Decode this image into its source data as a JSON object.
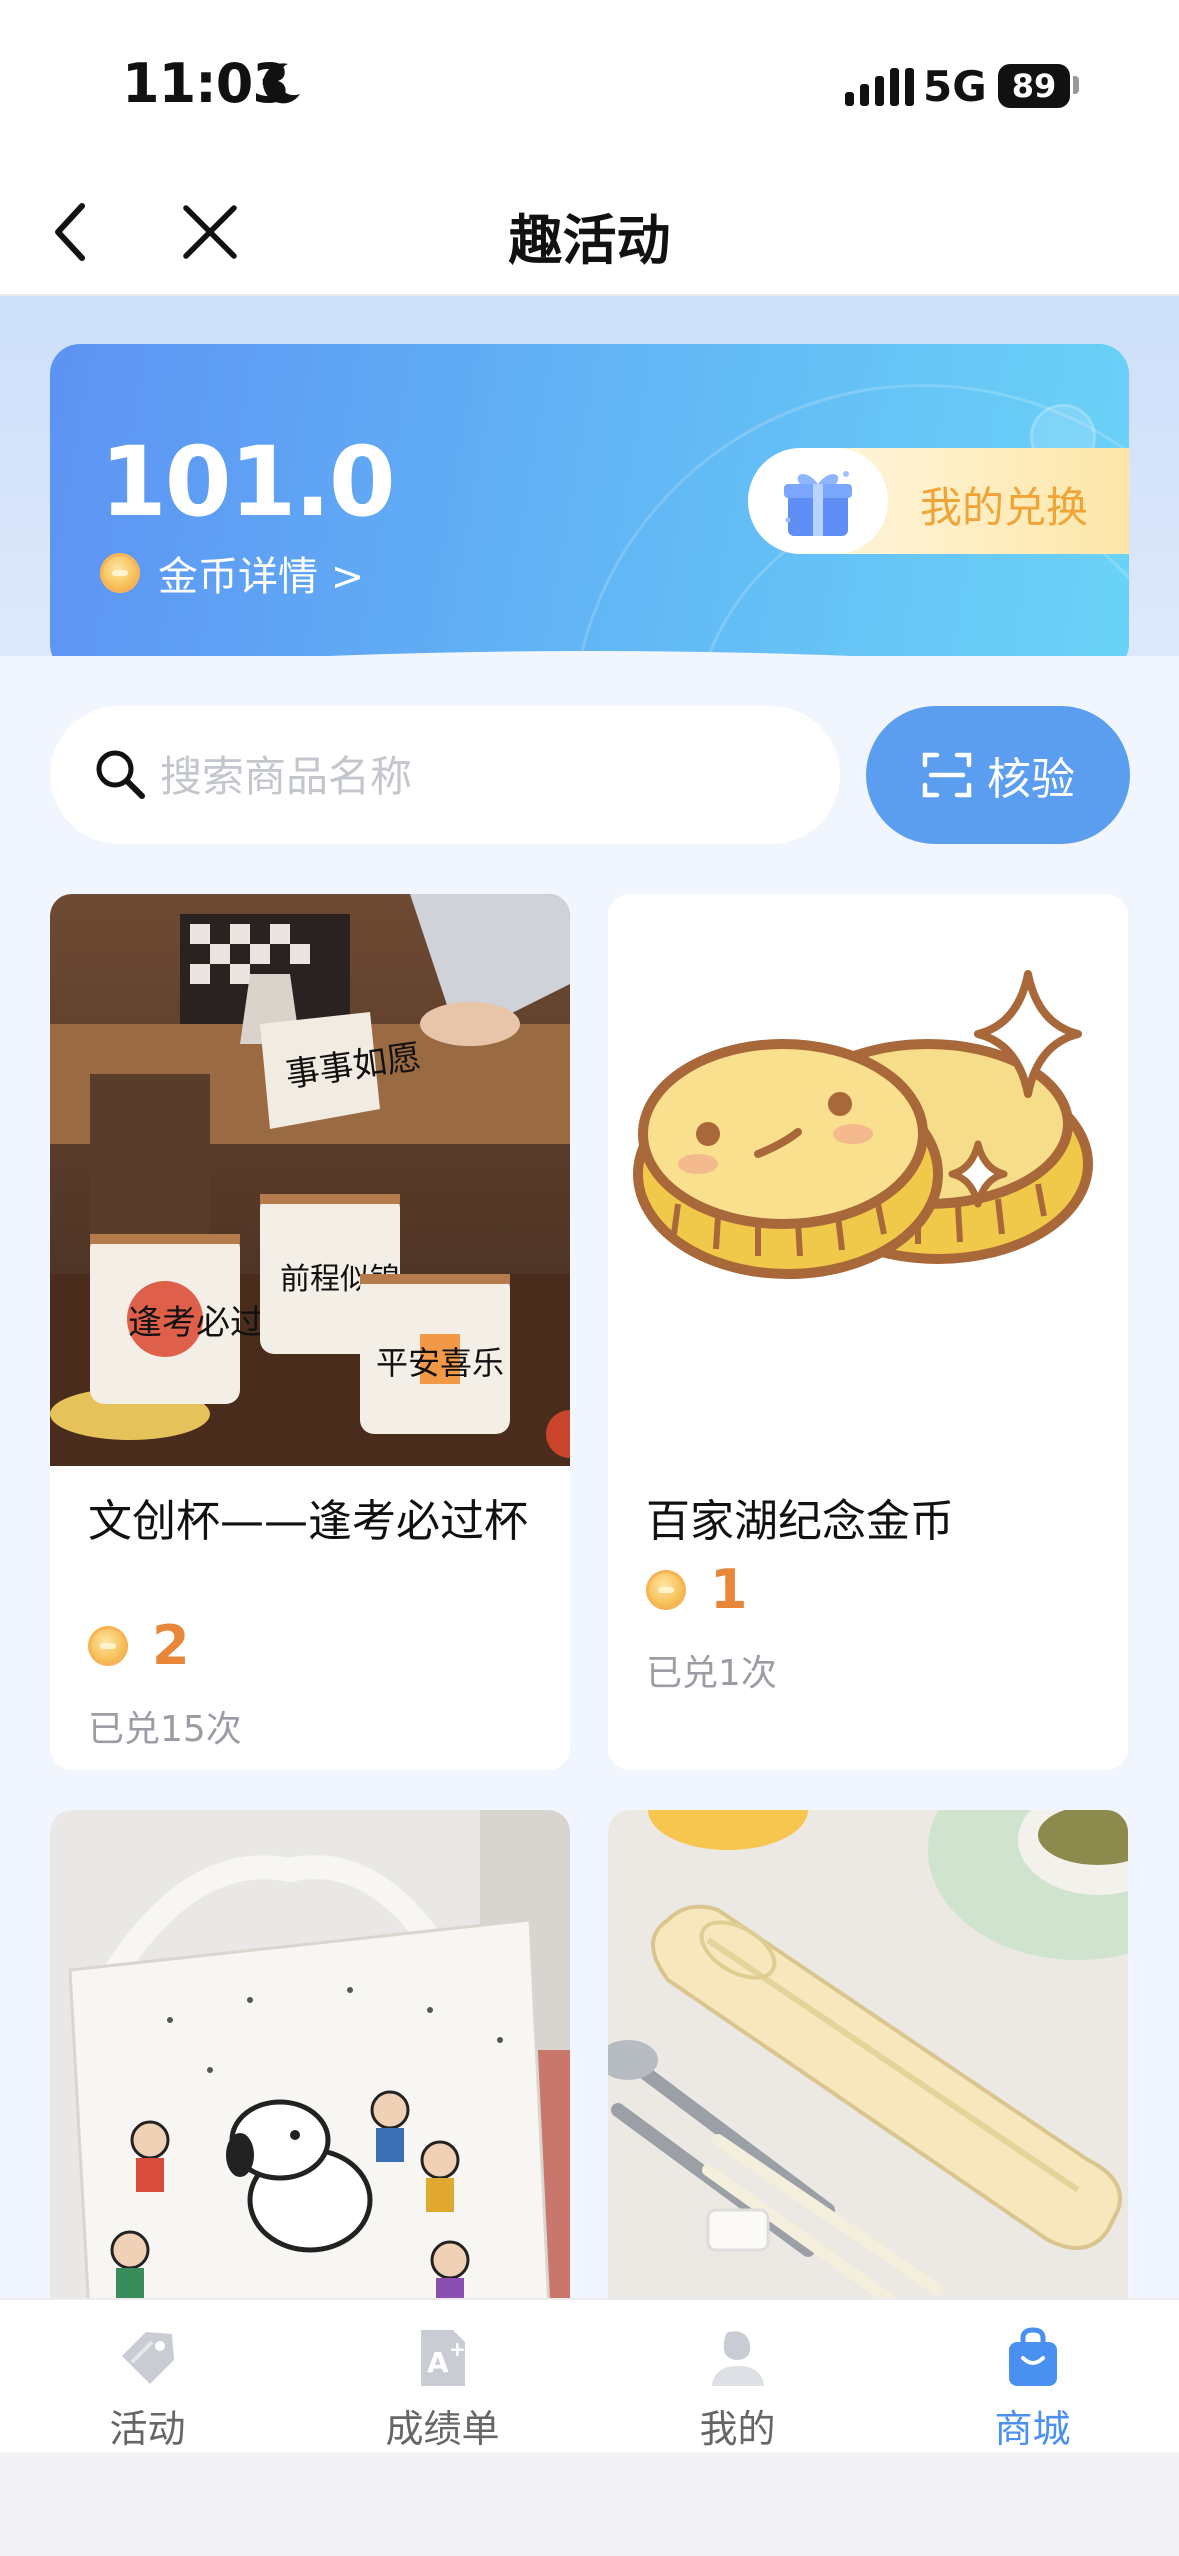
{
  "status_bar": {
    "time": "11:03",
    "network": "5G",
    "battery": "89"
  },
  "nav": {
    "title": "趣活动"
  },
  "coins": {
    "balance": "101.0",
    "detail_link": "金币详情 >",
    "my_exchange": "我的兑换"
  },
  "search": {
    "placeholder": "搜索商品名称",
    "verify_label": "核验"
  },
  "products": [
    {
      "name": "文创杯——逢考必过杯",
      "price": "2",
      "sold": "已兑15次"
    },
    {
      "name": "百家湖纪念金币",
      "price": "1",
      "sold": "已兑1次"
    },
    {
      "name": "",
      "price": "",
      "sold": ""
    },
    {
      "name": "",
      "price": "",
      "sold": ""
    }
  ],
  "mug_labels": [
    "事事如愿",
    "逢考必过",
    "前程似锦",
    "平安喜乐"
  ],
  "tabs": [
    {
      "label": "活动",
      "icon": "tag-icon"
    },
    {
      "label": "成绩单",
      "icon": "report-card-icon"
    },
    {
      "label": "我的",
      "icon": "profile-icon"
    },
    {
      "label": "商城",
      "icon": "shopping-bag-icon",
      "active": true
    }
  ],
  "colors": {
    "accent_blue": "#5b9ef0",
    "price_orange": "#e8873a",
    "exchange_gold": "#f0a437",
    "tab_active": "#4a90f0"
  }
}
